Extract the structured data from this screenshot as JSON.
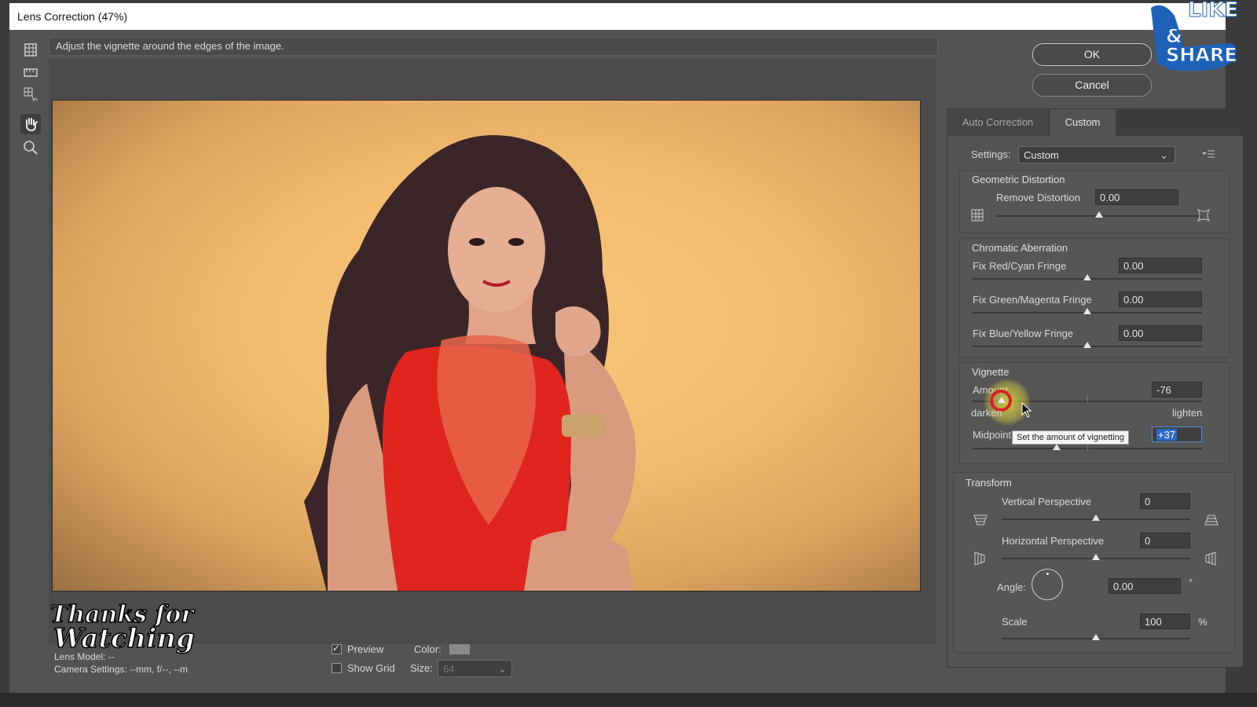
{
  "window": {
    "title": "Lens Correction (47%)"
  },
  "hint_text": "Adjust the vignette around the edges of the image.",
  "buttons": {
    "ok": "OK",
    "cancel": "Cancel"
  },
  "tabs": [
    {
      "label": "Auto Correction",
      "active": false
    },
    {
      "label": "Custom",
      "active": true
    }
  ],
  "settings": {
    "label": "Settings:",
    "value": "Custom"
  },
  "geometric": {
    "title": "Geometric Distortion",
    "remove_distortion": {
      "label": "Remove Distortion",
      "value": "0.00"
    }
  },
  "chromatic": {
    "title": "Chromatic Aberration",
    "items": [
      {
        "label": "Fix Red/Cyan Fringe",
        "value": "0.00"
      },
      {
        "label": "Fix Green/Magenta Fringe",
        "value": "0.00"
      },
      {
        "label": "Fix Blue/Yellow Fringe",
        "value": "0.00"
      }
    ]
  },
  "vignette": {
    "title": "Vignette",
    "amount": {
      "label": "Amount",
      "value": "-76"
    },
    "darken_label": "darken",
    "lighten_label": "lighten",
    "midpoint": {
      "label": "Midpoint",
      "value": "+37"
    },
    "tooltip": "Set the amount of vignetting"
  },
  "transform": {
    "title": "Transform",
    "vertical": {
      "label": "Vertical Perspective",
      "value": "0"
    },
    "horizontal": {
      "label": "Horizontal Perspective",
      "value": "0"
    },
    "angle": {
      "label": "Angle:",
      "value": "0.00",
      "unit": "°"
    },
    "scale": {
      "label": "Scale",
      "value": "100",
      "unit": "%"
    }
  },
  "bottom": {
    "preview_label": "Preview",
    "preview_checked": true,
    "show_grid_label": "Show Grid",
    "show_grid_checked": false,
    "color_label": "Color:",
    "size_label": "Size:",
    "size_value": "64",
    "lens_model": "Lens Model: --",
    "camera_settings": "Camera Settings: --mm, f/--, --m"
  },
  "overlay": {
    "thanks_line1": "Thanks for",
    "thanks_line2": "Watching",
    "like_line1": "LIKE",
    "like_line2": "& SHARE"
  },
  "tools": [
    "remove-distortion-icon",
    "straighten-icon",
    "move-grid-icon",
    "hand-icon",
    "zoom-icon"
  ]
}
